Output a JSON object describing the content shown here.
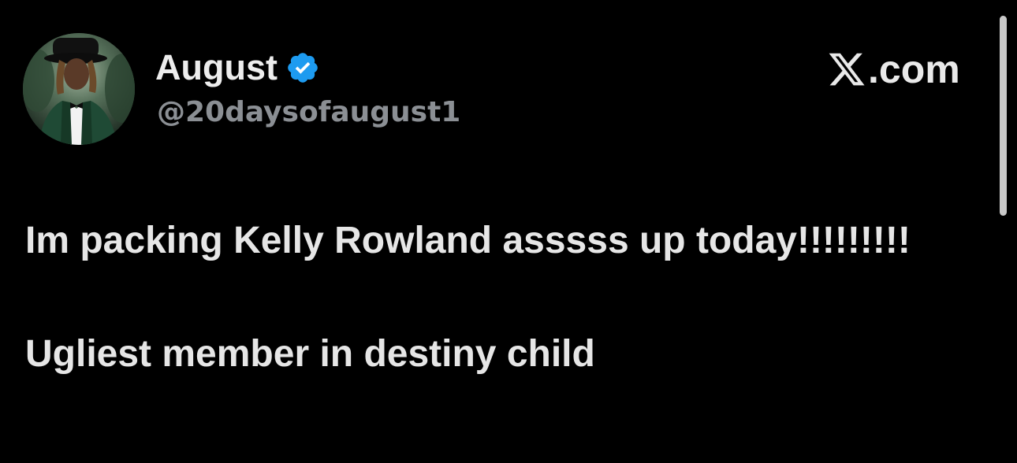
{
  "author": {
    "display_name": "August",
    "handle": "@20daysofaugust1",
    "verified_badge_icon": "verified-check-icon",
    "verified_color": "#1d9bf0",
    "avatar_icon": "profile-photo"
  },
  "source": {
    "logo_icon": "x-logo-icon",
    "domain_suffix": ".com"
  },
  "tweet": {
    "paragraphs": [
      "Im packing Kelly Rowland asssss up today!!!!!!!!!",
      "Ugliest member in destiny child"
    ]
  },
  "colors": {
    "background": "#000000",
    "primary_text": "#e7e9ea",
    "secondary_text": "#8b8f94",
    "scrollbar": "#c9c9c9"
  }
}
